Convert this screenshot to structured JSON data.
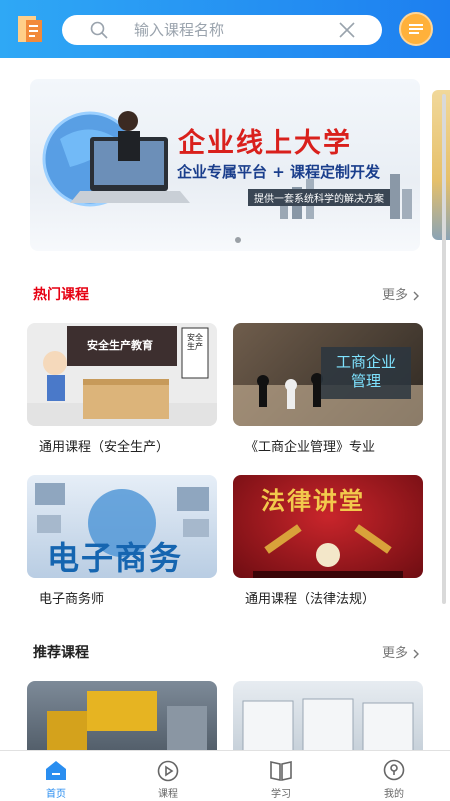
{
  "search": {
    "placeholder": "输入课程名称"
  },
  "banner": {
    "title": "企业线上大学",
    "subtitle": "企业专属平台 + 课程定制开发",
    "tagline": "提供一套系统科学的解决方案"
  },
  "hot": {
    "title": "热门课程",
    "more": "更多",
    "items": [
      {
        "caption": "通用课程（安全生产）",
        "art_title": "安全生产教育",
        "art_note": "安全生产"
      },
      {
        "caption": "《工商企业管理》专业",
        "art_title": "工商企业管理"
      },
      {
        "caption": "电子商务师",
        "art_title": "电子商务"
      },
      {
        "caption": "通用课程（法律法规）",
        "art_title": "法律讲堂"
      }
    ]
  },
  "recommend": {
    "title": "推荐课程",
    "more": "更多"
  },
  "tabbar": {
    "tabs": [
      {
        "label": "首页"
      },
      {
        "label": "课程"
      },
      {
        "label": "学习"
      },
      {
        "label": "我的"
      }
    ]
  },
  "colors": {
    "primary": "#1d7ff0",
    "hot_title": "#e60012",
    "accent": "#ffb13b"
  }
}
